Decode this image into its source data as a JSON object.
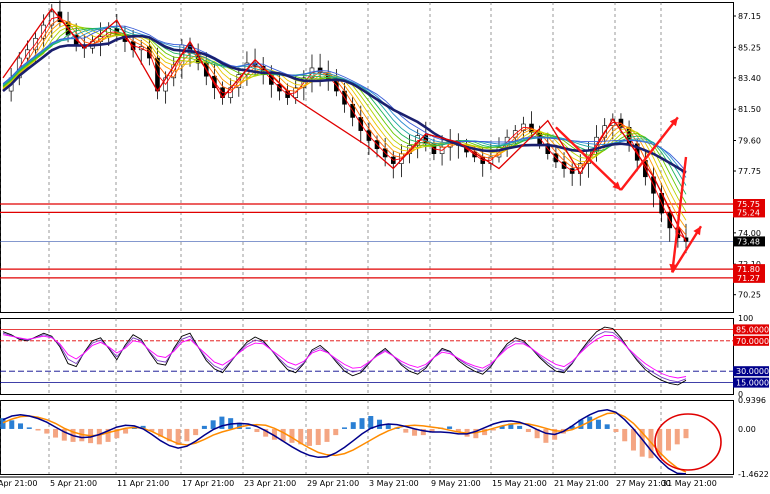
{
  "chart_data": [
    {
      "type": "candlestick",
      "panel": "price",
      "x_ticks": [
        "Apr 21:00",
        "5 Apr 21:00",
        "11 Apr 21:00",
        "17 Apr 21:00",
        "23 Apr 21:00",
        "29 Apr 21:00",
        "3 May 21:00",
        "9 May 21:00",
        "15 May 21:00",
        "21 May 21:00",
        "27 May 21:00",
        "31 May 21:00"
      ],
      "y_ticks": [
        "87.15",
        "85.25",
        "83.40",
        "81.50",
        "79.60",
        "77.75",
        "74.00",
        "72.10",
        "70.25"
      ],
      "ylim": [
        69.2,
        88.0
      ],
      "close_series": [
        82.6,
        83.4,
        84.6,
        85.1,
        85.8,
        86.6,
        87.4,
        86.8,
        86.0,
        85.4,
        85.2,
        85.6,
        85.9,
        86.4,
        86.0,
        85.6,
        85.1,
        85.3,
        84.6,
        82.6,
        83.4,
        84.2,
        85.4,
        84.9,
        84.3,
        83.5,
        82.8,
        82.2,
        82.8,
        83.6,
        84.3,
        84.1,
        83.6,
        83.0,
        82.6,
        82.2,
        82.8,
        83.4,
        84.0,
        83.7,
        83.3,
        82.6,
        81.8,
        81.0,
        80.2,
        79.6,
        79.1,
        78.6,
        78.2,
        78.8,
        79.3,
        79.9,
        79.4,
        78.8,
        79.2,
        79.6,
        79.3,
        78.9,
        78.6,
        78.2,
        78.6,
        79.2,
        79.8,
        80.2,
        80.6,
        80.1,
        79.4,
        78.8,
        78.3,
        77.9,
        77.6,
        78.2,
        79.0,
        79.8,
        80.5,
        80.9,
        80.4,
        79.4,
        78.4,
        77.4,
        76.4,
        75.2,
        74.3,
        73.7,
        73.48
      ],
      "price_boxes": [
        {
          "label": "75.75",
          "value": 75.75,
          "color": "#e00000"
        },
        {
          "label": "75.24",
          "value": 75.24,
          "color": "#e00000"
        },
        {
          "label": "73.48",
          "value": 73.48,
          "color": "#000000"
        },
        {
          "label": "71.80",
          "value": 71.8,
          "color": "#e00000"
        },
        {
          "label": "71.27",
          "value": 71.27,
          "color": "#e00000"
        }
      ],
      "horizontal_levels": [
        75.75,
        75.24,
        71.8,
        71.27
      ],
      "current_price_line": 73.48,
      "zigzag_points": [
        [
          0,
          83.4
        ],
        [
          6,
          87.6
        ],
        [
          10,
          85.2
        ],
        [
          14,
          86.9
        ],
        [
          19,
          82.6
        ],
        [
          23,
          85.6
        ],
        [
          27,
          82.2
        ],
        [
          31,
          84.5
        ],
        [
          36,
          82.1
        ],
        [
          45,
          79.2
        ],
        [
          48,
          77.9
        ],
        [
          52,
          80.0
        ],
        [
          56,
          79.5
        ],
        [
          61,
          77.9
        ],
        [
          67,
          80.8
        ],
        [
          71,
          77.6
        ],
        [
          75,
          80.9
        ],
        [
          80,
          77.4
        ],
        [
          84,
          73.48
        ]
      ],
      "arrows": [
        {
          "from": [
            68,
            80.4
          ],
          "to": [
            76,
            76.6
          ]
        },
        {
          "from": [
            76,
            76.6
          ],
          "to": [
            83,
            81.0
          ]
        },
        {
          "from": [
            84,
            78.6
          ],
          "to": [
            93,
            71.6
          ]
        },
        {
          "from": [
            93,
            71.6
          ],
          "to": [
            97,
            74.4
          ]
        }
      ]
    },
    {
      "type": "line",
      "panel": "oscillator",
      "y_ticks": [
        "100",
        "85.0000",
        "70.0000",
        "30.0000",
        "15.0000",
        "0"
      ],
      "ylim": [
        0,
        100
      ],
      "levels": [
        85,
        70,
        30,
        15
      ],
      "series": [
        {
          "values": [
            82,
            78,
            72,
            70,
            75,
            80,
            76,
            62,
            40,
            36,
            55,
            70,
            74,
            60,
            45,
            64,
            78,
            72,
            55,
            40,
            38,
            60,
            76,
            80,
            62,
            44,
            33,
            28,
            42,
            56,
            68,
            75,
            70,
            58,
            44,
            32,
            28,
            40,
            58,
            64,
            55,
            42,
            30,
            24,
            28,
            40,
            52,
            60,
            50,
            38,
            30,
            26,
            34,
            48,
            60,
            56,
            44,
            36,
            30,
            26,
            36,
            52,
            66,
            74,
            70,
            60,
            48,
            38,
            30,
            28,
            40,
            56,
            70,
            82,
            88,
            86,
            74,
            58,
            44,
            32,
            24,
            18,
            14,
            12,
            18
          ],
          "color": "#000000"
        },
        {
          "values": [
            80,
            77,
            73,
            71,
            74,
            78,
            75,
            64,
            46,
            40,
            54,
            67,
            71,
            61,
            49,
            62,
            74,
            70,
            56,
            44,
            42,
            58,
            72,
            76,
            62,
            47,
            37,
            32,
            43,
            55,
            65,
            71,
            68,
            58,
            46,
            36,
            32,
            41,
            56,
            61,
            54,
            44,
            34,
            29,
            31,
            41,
            51,
            58,
            50,
            40,
            34,
            30,
            36,
            48,
            58,
            55,
            46,
            39,
            34,
            30,
            38,
            51,
            63,
            70,
            68,
            60,
            50,
            41,
            34,
            31,
            41,
            55,
            67,
            77,
            82,
            81,
            72,
            58,
            46,
            35,
            28,
            22,
            18,
            16,
            20
          ],
          "color": "#7a3fc4"
        },
        {
          "values": [
            78,
            76,
            74,
            72,
            74,
            76,
            74,
            66,
            52,
            46,
            54,
            64,
            68,
            62,
            54,
            60,
            70,
            68,
            58,
            50,
            48,
            56,
            68,
            72,
            62,
            52,
            42,
            38,
            45,
            54,
            62,
            67,
            66,
            58,
            50,
            42,
            38,
            43,
            54,
            58,
            54,
            46,
            39,
            34,
            35,
            42,
            50,
            56,
            50,
            43,
            38,
            35,
            39,
            48,
            55,
            53,
            47,
            41,
            37,
            34,
            40,
            50,
            60,
            66,
            66,
            60,
            52,
            45,
            39,
            36,
            43,
            54,
            64,
            72,
            77,
            77,
            70,
            59,
            49,
            40,
            33,
            27,
            23,
            21,
            23
          ],
          "color": "#ff00ff"
        }
      ]
    },
    {
      "type": "bar",
      "panel": "histogram",
      "y_ticks": [
        "0.9396",
        "0.00",
        "-1.4622"
      ],
      "ylim": [
        -1.4622,
        0.9396
      ],
      "values": [
        0.35,
        0.28,
        0.18,
        0.05,
        -0.05,
        -0.15,
        -0.28,
        -0.38,
        -0.42,
        -0.4,
        -0.46,
        -0.5,
        -0.42,
        -0.3,
        -0.15,
        0.06,
        0.1,
        -0.08,
        -0.25,
        -0.4,
        -0.52,
        -0.4,
        -0.2,
        0.1,
        0.28,
        0.4,
        0.35,
        0.2,
        0.05,
        -0.1,
        -0.25,
        -0.35,
        -0.4,
        -0.45,
        -0.5,
        -0.55,
        -0.52,
        -0.42,
        -0.2,
        0.05,
        0.22,
        0.35,
        0.42,
        0.3,
        0.15,
        0.05,
        -0.12,
        -0.22,
        -0.2,
        -0.1,
        0.04,
        0.08,
        -0.1,
        -0.25,
        -0.3,
        -0.2,
        -0.05,
        0.1,
        0.18,
        0.1,
        -0.1,
        -0.3,
        -0.45,
        -0.35,
        -0.15,
        0.1,
        0.3,
        0.4,
        0.3,
        0.15,
        -0.1,
        -0.4,
        -0.7,
        -0.9,
        -0.95,
        -0.85,
        -0.7,
        -0.5,
        -0.3
      ],
      "series": [
        {
          "values": [
            0.2,
            0.32,
            0.4,
            0.42,
            0.38,
            0.3,
            0.18,
            0.02,
            -0.1,
            -0.18,
            -0.22,
            -0.2,
            -0.12,
            -0.05,
            0.02,
            0.05,
            0.02,
            -0.08,
            -0.22,
            -0.36,
            -0.48,
            -0.52,
            -0.46,
            -0.34,
            -0.2,
            -0.1,
            -0.02,
            0.06,
            0.12,
            0.14,
            0.12,
            0.02,
            -0.12,
            -0.28,
            -0.46,
            -0.62,
            -0.76,
            -0.84,
            -0.86,
            -0.8,
            -0.68,
            -0.52,
            -0.36,
            -0.2,
            -0.06,
            0.04,
            0.1,
            0.12,
            0.1,
            0.06,
            0.02,
            -0.04,
            -0.1,
            -0.14,
            -0.12,
            -0.06,
            0.02,
            0.1,
            0.16,
            0.18,
            0.16,
            0.1,
            0.02,
            -0.06,
            -0.08,
            -0.02,
            0.1,
            0.24,
            0.38,
            0.5,
            0.52,
            0.4,
            0.18,
            -0.12,
            -0.44,
            -0.76,
            -1.04,
            -1.26,
            -1.4
          ],
          "color": "#ff8c00"
        },
        {
          "values": [
            0.3,
            0.42,
            0.46,
            0.42,
            0.34,
            0.22,
            0.06,
            -0.1,
            -0.22,
            -0.28,
            -0.26,
            -0.18,
            -0.06,
            0.06,
            0.12,
            0.1,
            0.0,
            -0.18,
            -0.38,
            -0.54,
            -0.62,
            -0.56,
            -0.4,
            -0.2,
            -0.02,
            0.1,
            0.16,
            0.18,
            0.16,
            0.08,
            -0.06,
            -0.22,
            -0.4,
            -0.58,
            -0.74,
            -0.86,
            -0.92,
            -0.9,
            -0.78,
            -0.6,
            -0.38,
            -0.16,
            0.02,
            0.12,
            0.16,
            0.14,
            0.08,
            0.0,
            -0.06,
            -0.1,
            -0.1,
            -0.12,
            -0.16,
            -0.16,
            -0.08,
            0.04,
            0.16,
            0.24,
            0.26,
            0.22,
            0.12,
            -0.02,
            -0.14,
            -0.18,
            -0.08,
            0.1,
            0.3,
            0.46,
            0.58,
            0.62,
            0.54,
            0.3,
            0.0,
            -0.34,
            -0.7,
            -1.02,
            -1.28,
            -1.44,
            -1.46
          ],
          "color": "#00008b"
        }
      ],
      "annotation": "ellipse-highlight"
    }
  ]
}
